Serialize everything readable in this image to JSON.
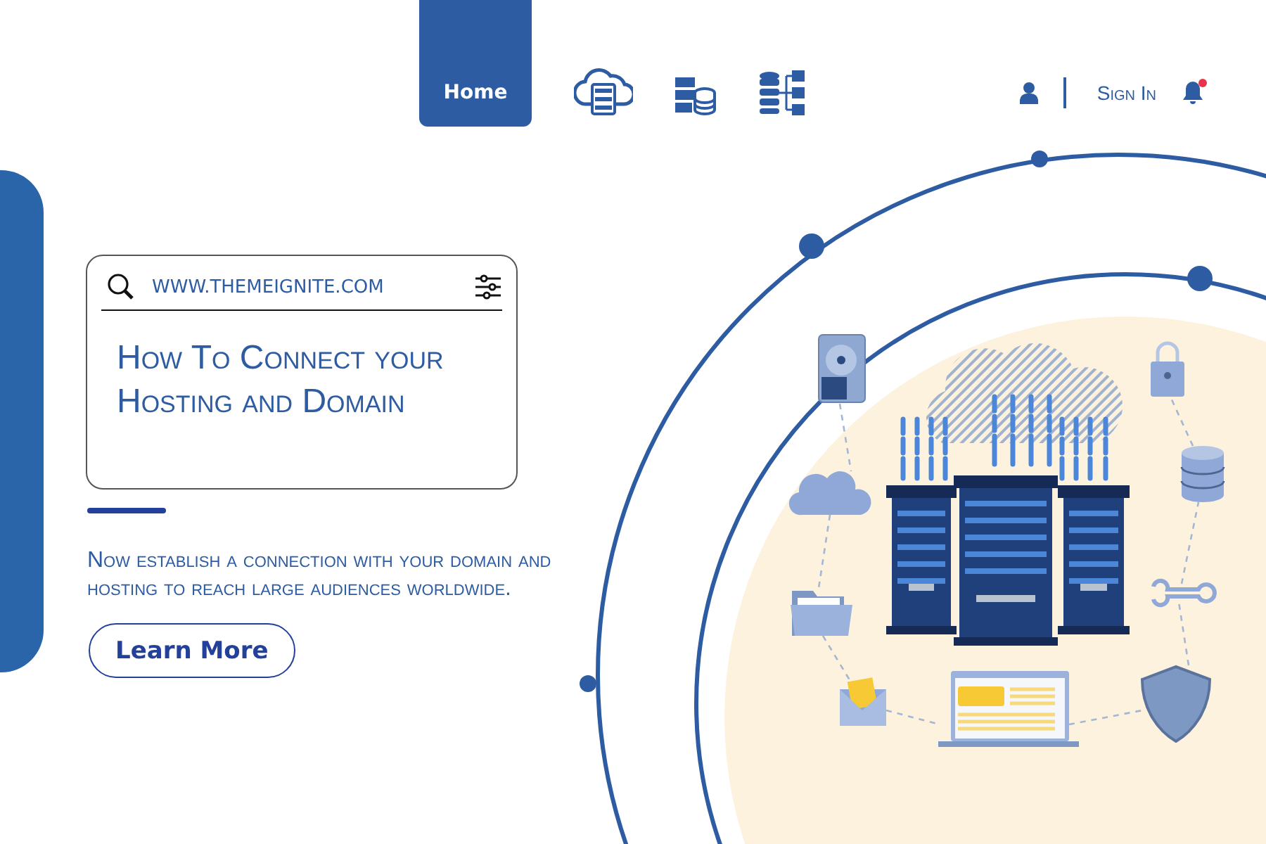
{
  "nav": {
    "tabs": [
      {
        "kind": "text",
        "label": "Home",
        "selected": true
      },
      {
        "kind": "cloud-server",
        "selected": false
      },
      {
        "kind": "server-database",
        "selected": false
      },
      {
        "kind": "database-network",
        "selected": false
      }
    ],
    "sign_in": "Sign In",
    "has_notification": true
  },
  "card": {
    "search": {
      "value": "WWW.THEMEIGNITE.COM"
    },
    "headline": "How To Connect your Hosting and Domain"
  },
  "description": "Now establish a connection with your domain and hosting to reach large audiences worldwide.",
  "cta": "Learn More"
}
